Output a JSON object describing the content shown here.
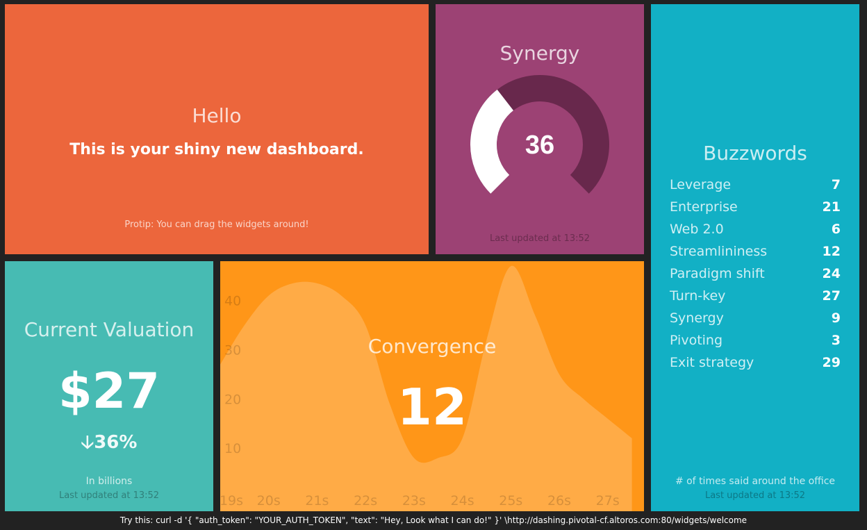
{
  "hello": {
    "title": "Hello",
    "text": "This is your shiny new dashboard.",
    "more_info": "Protip: You can drag the widgets around!"
  },
  "synergy": {
    "title": "Synergy",
    "value": "36",
    "value_fraction": 0.36,
    "updated": "Last updated at 13:52"
  },
  "buzzwords": {
    "title": "Buzzwords",
    "items": [
      {
        "label": "Leverage",
        "value": "7"
      },
      {
        "label": "Enterprise",
        "value": "21"
      },
      {
        "label": "Web 2.0",
        "value": "6"
      },
      {
        "label": "Streamlininess",
        "value": "12"
      },
      {
        "label": "Paradigm shift",
        "value": "24"
      },
      {
        "label": "Turn-key",
        "value": "27"
      },
      {
        "label": "Synergy",
        "value": "9"
      },
      {
        "label": "Pivoting",
        "value": "3"
      },
      {
        "label": "Exit strategy",
        "value": "29"
      }
    ],
    "more_info": "# of times said around the office",
    "updated": "Last updated at 13:52"
  },
  "valuation": {
    "title": "Current Valuation",
    "value": "$27",
    "change": "36%",
    "change_direction": "down",
    "more_info": "In billions",
    "updated": "Last updated at 13:52"
  },
  "convergence": {
    "title": "Convergence",
    "value": "12"
  },
  "chart_data": {
    "type": "area",
    "x": [
      19,
      19.5,
      20,
      20.5,
      21,
      21.5,
      22,
      22.5,
      23,
      23.5,
      24,
      24.5,
      25,
      25.5,
      26,
      26.5,
      27,
      27.5
    ],
    "x_tick_labels": [
      "19s",
      "20s",
      "21s",
      "22s",
      "23s",
      "24s",
      "25s",
      "26s",
      "27s"
    ],
    "y": [
      27,
      35,
      41,
      43.5,
      43.5,
      41,
      35,
      19,
      8,
      8,
      12,
      32,
      47,
      37,
      25,
      20,
      16,
      12
    ],
    "y_ticks": [
      "10",
      "20",
      "30",
      "40"
    ],
    "xlim": [
      19,
      27.75
    ],
    "ylim": [
      0,
      48
    ]
  },
  "footer": {
    "text": "Try this: curl -d '{ \"auth_token\": \"YOUR_AUTH_TOKEN\", \"text\": \"Hey, Look what I can do!\" }' \\http://dashing.pivotal-cf.altoros.com:80/widgets/welcome"
  },
  "colors": {
    "background": "#222222",
    "hello": "#ec663c",
    "synergy": "#9c4274",
    "buzzwords": "#12b0c5",
    "valuation": "#47bbb3",
    "convergence": "#ff9618"
  }
}
